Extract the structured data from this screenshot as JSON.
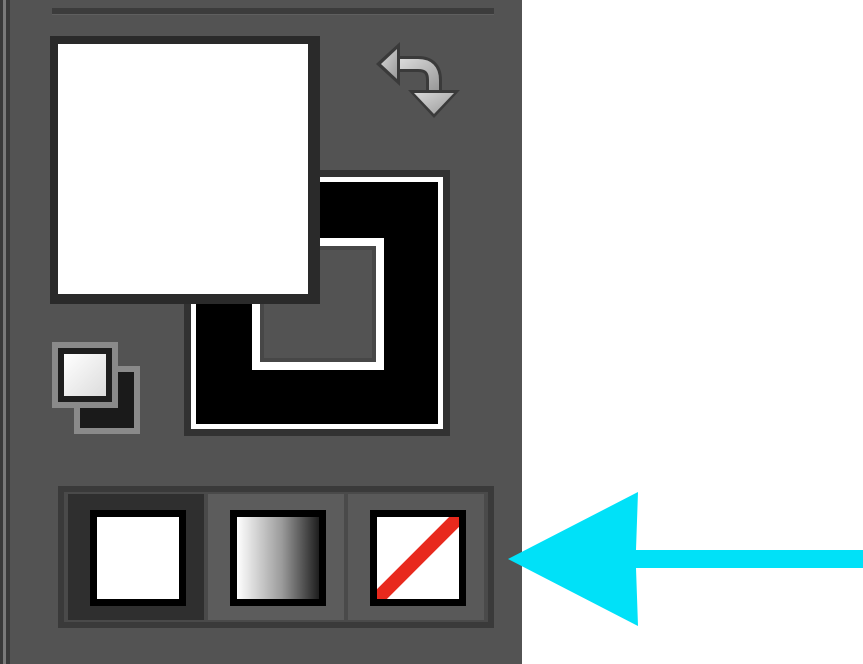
{
  "panel": {
    "swap_colors": {
      "icon": "swap-arrows-icon"
    },
    "fill_swatch": {
      "color": "#ffffff"
    },
    "stroke_swatch": {
      "color": "#000000"
    },
    "default_colors": {
      "icon": "default-fill-stroke-icon"
    },
    "fill_modes": {
      "selected": "color",
      "buttons": [
        {
          "id": "color",
          "icon": "solid-color-icon",
          "color": "#ffffff"
        },
        {
          "id": "gradient",
          "icon": "gradient-icon",
          "from": "#ffffff",
          "to": "#1e1e1e"
        },
        {
          "id": "none",
          "icon": "none-icon",
          "slash_color": "#e8291d"
        }
      ]
    }
  },
  "annotation": {
    "arrow_color": "#00e1f8",
    "direction": "left"
  }
}
